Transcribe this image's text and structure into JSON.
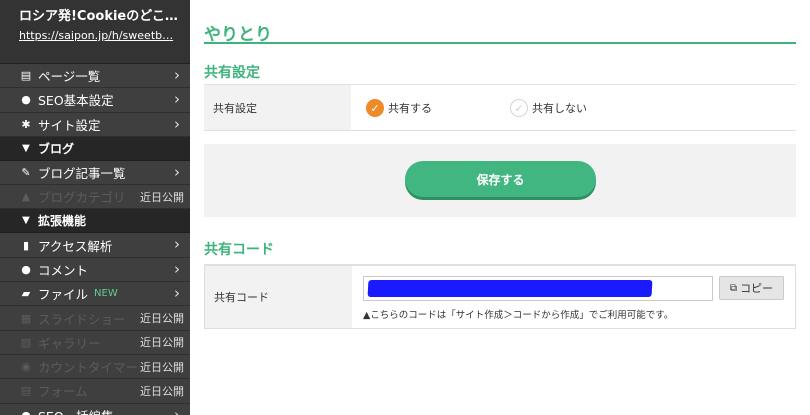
{
  "sidebar": {
    "site_title": "ロシア発!Cookieのどこ…",
    "site_url": "https://saipon.jp/h/sweetb…",
    "items_top": [
      {
        "label": "ページ一覧",
        "icon": "▤"
      },
      {
        "label": "SEO基本設定",
        "icon": "●"
      },
      {
        "label": "サイト設定",
        "icon": "✱"
      }
    ],
    "blog_header": "ブログ",
    "blog_items": [
      {
        "label": "ブログ記事一覧",
        "icon": "✎"
      }
    ],
    "blog_disabled": [
      {
        "label": "ブログカテゴリ",
        "icon": "▲",
        "badge": "近日公開"
      }
    ],
    "ext_header": "拡張機能",
    "ext_items": [
      {
        "label": "アクセス解析",
        "icon": "▮"
      },
      {
        "label": "コメント",
        "icon": "●"
      },
      {
        "label": "ファイル",
        "icon": "▰",
        "new": "NEW"
      }
    ],
    "ext_disabled": [
      {
        "label": "スライドショー",
        "icon": "▦",
        "badge": "近日公開"
      },
      {
        "label": "ギャラリー",
        "icon": "▨",
        "badge": "近日公開"
      },
      {
        "label": "カウントタイマー",
        "icon": "◉",
        "badge": "近日公開"
      },
      {
        "label": "フォーム",
        "icon": "▤",
        "badge": "近日公開"
      }
    ],
    "last_item": {
      "label": "SEO一括編集",
      "icon": "●"
    }
  },
  "main": {
    "page_title": "やりとり",
    "share_section_title": "共有設定",
    "share_label": "共有設定",
    "share_on": "共有する",
    "share_off": "共有しない",
    "save_button": "保存する",
    "code_section_title": "共有コード",
    "code_label": "共有コード",
    "copy_button": "コピー",
    "code_note": "▲こちらのコードは「サイト作成＞コードから作成」でご利用可能です。"
  },
  "colors": {
    "accent": "#3eb37b",
    "radio_on": "#ef8a28",
    "sidebar_bg": "#3f3f3f"
  }
}
